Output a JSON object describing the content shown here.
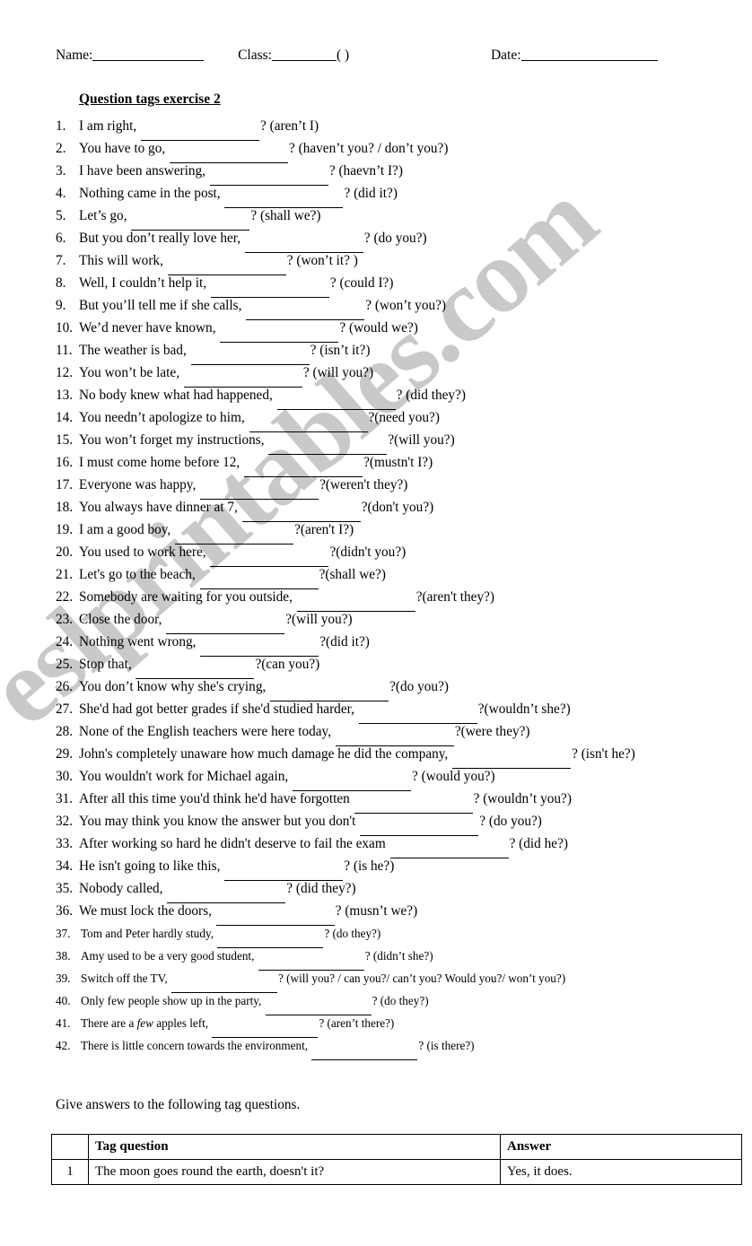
{
  "watermark": {
    "text": "eslprintables.com"
  },
  "header": {
    "name_label": "Name:",
    "class_label": "Class:",
    "paren": "(    )",
    "date_label": "Date:"
  },
  "exercise": {
    "title": "Question tags exercise 2",
    "items": [
      {
        "num": "1.",
        "text": "I am right,",
        "blank": 132,
        "tag": "? (aren’t I)"
      },
      {
        "num": "2.",
        "text": "You have to go,",
        "blank": 132,
        "tag": "? (haven’t you? / don’t you?)"
      },
      {
        "num": "3.",
        "text": "I have been answering,",
        "blank": 132,
        "tag": "? (haevn’t I?)"
      },
      {
        "num": "4.",
        "text": "Nothing came in the post,",
        "blank": 132,
        "tag": "? (did it?)"
      },
      {
        "num": "5.",
        "text": "Let’s go,",
        "blank": 132,
        "tag": "? (shall we?)"
      },
      {
        "num": "6.",
        "text": "But you don’t really love her,",
        "blank": 132,
        "tag": "? (do you?)"
      },
      {
        "num": "7.",
        "text": "This will work,",
        "blank": 132,
        "tag": "? (won’t it? )"
      },
      {
        "num": "8.",
        "text": "Well, I couldn’t help it,",
        "blank": 132,
        "tag": "? (could I?)"
      },
      {
        "num": "9.",
        "text": "But you’ll tell me if she calls,",
        "blank": 132,
        "tag": "? (won’t you?)"
      },
      {
        "num": "10.",
        "text": "We’d never have known,",
        "blank": 132,
        "tag": "? (would we?)"
      },
      {
        "num": "11.",
        "text": "The weather is bad,",
        "blank": 132,
        "tag": "? (isn’t it?)"
      },
      {
        "num": "12.",
        "text": "You won’t be late,",
        "blank": 132,
        "tag": "? (will you?)"
      },
      {
        "num": "13.",
        "text": "No body knew what had happened,",
        "blank": 132,
        "tag": "? (did they?)"
      },
      {
        "num": "14.",
        "text": "You needn’t apologize to him,",
        "blank": 132,
        "tag": "?(need you?)"
      },
      {
        "num": "15.",
        "text": "You won’t forget my instructions,",
        "blank": 132,
        "tag": "?(will you?)"
      },
      {
        "num": "16.",
        "text": "I must come home before 12,",
        "blank": 132,
        "tag": "?(mustn't I?)"
      },
      {
        "num": "17.",
        "text": "Everyone was happy,",
        "blank": 132,
        "tag": "?(weren't they?)"
      },
      {
        "num": "18.",
        "text": "You always have dinner at 7,",
        "blank": 132,
        "tag": "?(don't you?)"
      },
      {
        "num": "19.",
        "text": "I am a good boy,",
        "blank": 132,
        "tag": "?(aren't I?)"
      },
      {
        "num": "20.",
        "text": "You used to work here,",
        "blank": 132,
        "tag": "?(didn't you?)"
      },
      {
        "num": "21.",
        "text": "Let's go to the beach,",
        "blank": 132,
        "tag": "?(shall we?)"
      },
      {
        "num": "22.",
        "text": "Somebody are waiting for you outside,",
        "blank": 132,
        "tag": "?(aren't they?)"
      },
      {
        "num": "23.",
        "text": "Close the door,",
        "blank": 132,
        "tag": "?(will you?)"
      },
      {
        "num": "24.",
        "text": "Nothing went wrong,",
        "blank": 132,
        "tag": "?(did it?)"
      },
      {
        "num": "25.",
        "text": "Stop that,",
        "blank": 132,
        "tag": "?(can you?)"
      },
      {
        "num": "26.",
        "text": "You don’t know why she's crying,",
        "blank": 132,
        "tag": "?(do you?)"
      },
      {
        "num": "27.",
        "text": "She'd had got better grades if she'd studied harder,",
        "blank": 132,
        "tag": "?(wouldn’t she?)"
      },
      {
        "num": "28.",
        "text": "None of the English teachers were here today,",
        "blank": 132,
        "tag": "?(were they?)"
      },
      {
        "num": "29.",
        "text": "John's completely unaware how much damage he did the company,",
        "blank": 132,
        "tag": "? (isn't he?)"
      },
      {
        "num": "30.",
        "text": "You wouldn't work for Michael again,",
        "blank": 132,
        "tag": "? (would you?)"
      },
      {
        "num": "31.",
        "text": "After all this time you'd think he'd have forgotten",
        "blank": 132,
        "tag": "? (wouldn’t you?)"
      },
      {
        "num": "32.",
        "text": "You may think you know the answer but you don't",
        "blank": 132,
        "tag": "? (do you?)"
      },
      {
        "num": "33.",
        "text": "After working so hard he didn't deserve to fail the exam",
        "blank": 132,
        "tag": "? (did he?)"
      },
      {
        "num": "34.",
        "text": "He isn't going to like this,",
        "blank": 132,
        "tag": "? (is he?)"
      },
      {
        "num": "35.",
        "text": "Nobody called,",
        "blank": 132,
        "tag": "? (did they?)"
      },
      {
        "num": "36.",
        "text": "We must lock the doors,",
        "blank": 132,
        "tag": "? (musn’t we?)"
      },
      {
        "num": "37.",
        "text": "Tom and Peter hardly study,",
        "blank": 118,
        "tag": "? (do they?)",
        "small": true
      },
      {
        "num": "38.",
        "text": "Amy used to be a very good student,",
        "blank": 118,
        "tag": "? (didn’t she?)",
        "small": true
      },
      {
        "num": "39.",
        "text": "Switch off the TV,",
        "blank": 118,
        "tag": "? (will you? / can you?/ can’t you? Would you?/ won’t you?)",
        "small": true
      },
      {
        "num": "40.",
        "text": "Only few people show up in the party,",
        "blank": 118,
        "tag": "? (do they?)",
        "small": true
      },
      {
        "num": "41.",
        "text": "There are a few apples left,",
        "blank": 118,
        "tag": "? (aren’t there?)",
        "small": true,
        "italic_word": "few"
      },
      {
        "num": "42.",
        "text": "There is little concern towards the environment,",
        "blank": 118,
        "tag": "? (is there?)",
        "small": true
      }
    ]
  },
  "instruction": "Give answers to the following tag questions.",
  "answer_table": {
    "headers": {
      "index": "",
      "question": "Tag question",
      "answer": "Answer"
    },
    "rows": [
      {
        "index": "1",
        "question": "The moon goes round the earth, doesn't it?",
        "answer": "Yes, it does."
      }
    ]
  }
}
